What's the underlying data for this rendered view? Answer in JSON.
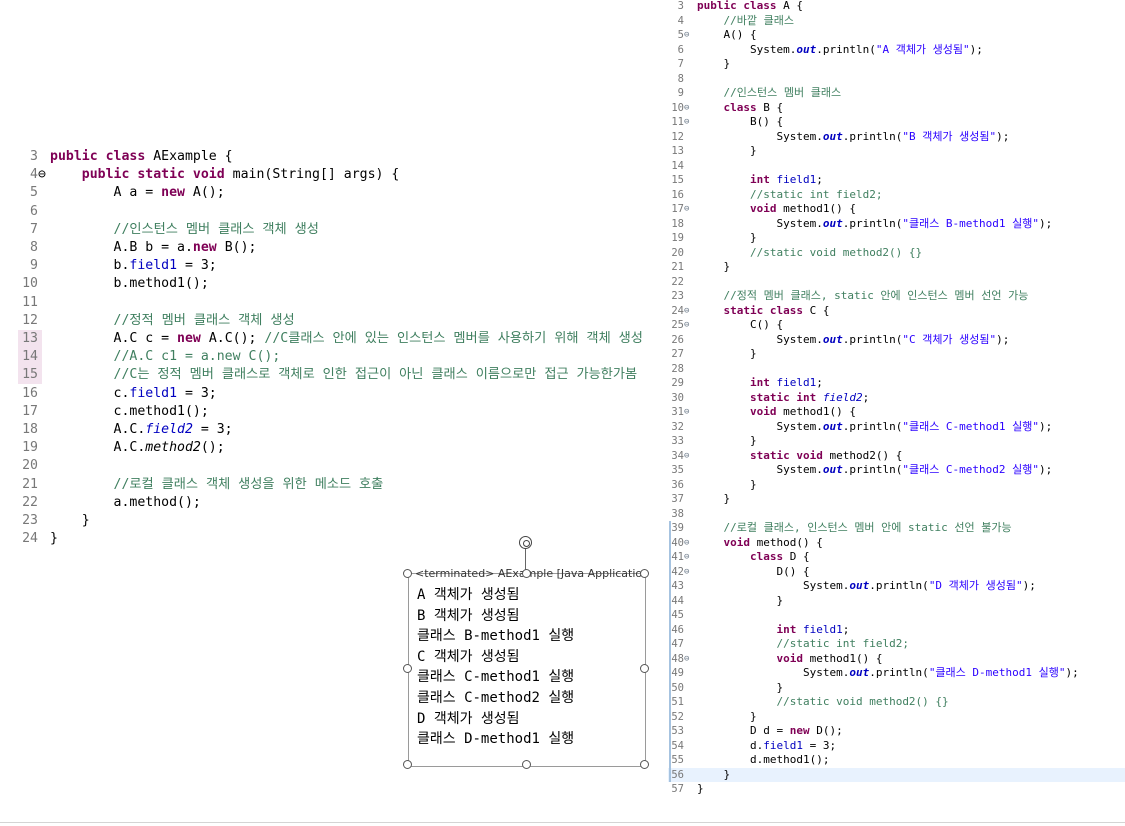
{
  "left_editor": {
    "lines": [
      {
        "n": "3",
        "tokens": [
          [
            "kw",
            "public class "
          ],
          [
            "",
            "AExample {"
          ]
        ]
      },
      {
        "n": "4",
        "fold": "⊖",
        "tokens": [
          [
            "",
            "    "
          ],
          [
            "kw",
            "public static void "
          ],
          [
            "",
            "main(String[] args) {"
          ]
        ]
      },
      {
        "n": "5",
        "tokens": [
          [
            "",
            "        A a = "
          ],
          [
            "kw",
            "new "
          ],
          [
            "",
            "A();"
          ]
        ]
      },
      {
        "n": "6",
        "tokens": []
      },
      {
        "n": "7",
        "tokens": [
          [
            "",
            "        "
          ],
          [
            "cm",
            "//인스턴스 멤버 클래스 객체 생성"
          ]
        ]
      },
      {
        "n": "8",
        "tokens": [
          [
            "",
            "        A.B b = a."
          ],
          [
            "kw",
            "new "
          ],
          [
            "",
            "B();"
          ]
        ]
      },
      {
        "n": "9",
        "tokens": [
          [
            "",
            "        b."
          ],
          [
            "fd",
            "field1"
          ],
          [
            "",
            " = 3;"
          ]
        ]
      },
      {
        "n": "10",
        "tokens": [
          [
            "",
            "        b.method1();"
          ]
        ]
      },
      {
        "n": "11",
        "tokens": []
      },
      {
        "n": "12",
        "tokens": [
          [
            "",
            "        "
          ],
          [
            "cm",
            "//정적 멤버 클래스 객체 생성"
          ]
        ]
      },
      {
        "n": "13",
        "hl": true,
        "tokens": [
          [
            "",
            "        A.C c = "
          ],
          [
            "kw",
            "new "
          ],
          [
            "",
            "A.C(); "
          ],
          [
            "cm",
            "//C클래스 안에 있는 인스턴스 멤버를 사용하기 위해 객체 생성"
          ]
        ]
      },
      {
        "n": "14",
        "hl": true,
        "tokens": [
          [
            "",
            "        "
          ],
          [
            "cm",
            "//A.C c1 = a.new C();"
          ]
        ]
      },
      {
        "n": "15",
        "hl": true,
        "tokens": [
          [
            "",
            "        "
          ],
          [
            "cm",
            "//C는 정적 멤버 클래스로 객체로 인한 접근이 아닌 클래스 이름으로만 접근 가능한가봄"
          ]
        ]
      },
      {
        "n": "16",
        "tokens": [
          [
            "",
            "        c."
          ],
          [
            "fd",
            "field1"
          ],
          [
            "",
            " = 3;"
          ]
        ]
      },
      {
        "n": "17",
        "tokens": [
          [
            "",
            "        c.method1();"
          ]
        ]
      },
      {
        "n": "18",
        "tokens": [
          [
            "",
            "        A.C."
          ],
          [
            "sfd",
            "field2"
          ],
          [
            "",
            " = 3;"
          ]
        ]
      },
      {
        "n": "19",
        "tokens": [
          [
            "",
            "        A.C."
          ],
          [
            "ita",
            "method2"
          ],
          [
            "",
            "();"
          ]
        ]
      },
      {
        "n": "20",
        "tokens": []
      },
      {
        "n": "21",
        "tokens": [
          [
            "",
            "        "
          ],
          [
            "cm",
            "//로컬 클래스 객체 생성을 위한 메소드 호출"
          ]
        ]
      },
      {
        "n": "22",
        "tokens": [
          [
            "",
            "        a.method();"
          ]
        ]
      },
      {
        "n": "23",
        "tokens": [
          [
            "",
            "    }"
          ]
        ]
      },
      {
        "n": "24",
        "tokens": [
          [
            "",
            "}"
          ]
        ]
      }
    ]
  },
  "right_editor": {
    "lines": [
      {
        "n": "3",
        "tokens": [
          [
            "kw",
            "public class "
          ],
          [
            "",
            "A {"
          ]
        ]
      },
      {
        "n": "4",
        "tokens": [
          [
            "",
            "    "
          ],
          [
            "cm",
            "//바깥 클래스"
          ]
        ]
      },
      {
        "n": "5",
        "fold": "⊖",
        "tokens": [
          [
            "",
            "    A() {"
          ]
        ]
      },
      {
        "n": "6",
        "tokens": [
          [
            "",
            "        System."
          ],
          [
            "sobj",
            "out"
          ],
          [
            "",
            ".println("
          ],
          [
            "st",
            "\"A 객체가 생성됨\""
          ],
          [
            "",
            ");"
          ]
        ]
      },
      {
        "n": "7",
        "tokens": [
          [
            "",
            "    }"
          ]
        ]
      },
      {
        "n": "8",
        "tokens": []
      },
      {
        "n": "9",
        "tokens": [
          [
            "",
            "    "
          ],
          [
            "cm",
            "//인스턴스 멤버 클래스"
          ]
        ]
      },
      {
        "n": "10",
        "fold": "⊖",
        "tokens": [
          [
            "",
            "    "
          ],
          [
            "kw",
            "class "
          ],
          [
            "",
            "B {"
          ]
        ]
      },
      {
        "n": "11",
        "fold": "⊖",
        "tokens": [
          [
            "",
            "        B() {"
          ]
        ]
      },
      {
        "n": "12",
        "tokens": [
          [
            "",
            "            System."
          ],
          [
            "sobj",
            "out"
          ],
          [
            "",
            ".println("
          ],
          [
            "st",
            "\"B 객체가 생성됨\""
          ],
          [
            "",
            ");"
          ]
        ]
      },
      {
        "n": "13",
        "tokens": [
          [
            "",
            "        }"
          ]
        ]
      },
      {
        "n": "14",
        "tokens": []
      },
      {
        "n": "15",
        "tokens": [
          [
            "",
            "        "
          ],
          [
            "kw",
            "int "
          ],
          [
            "fd",
            "field1"
          ],
          [
            "",
            ";"
          ]
        ]
      },
      {
        "n": "16",
        "tokens": [
          [
            "",
            "        "
          ],
          [
            "cm",
            "//static int field2;"
          ]
        ]
      },
      {
        "n": "17",
        "fold": "⊖",
        "tokens": [
          [
            "",
            "        "
          ],
          [
            "kw",
            "void "
          ],
          [
            "",
            "method1() {"
          ]
        ]
      },
      {
        "n": "18",
        "tokens": [
          [
            "",
            "            System."
          ],
          [
            "sobj",
            "out"
          ],
          [
            "",
            ".println("
          ],
          [
            "st",
            "\"클래스 B-method1 실행\""
          ],
          [
            "",
            ");"
          ]
        ]
      },
      {
        "n": "19",
        "tokens": [
          [
            "",
            "        }"
          ]
        ]
      },
      {
        "n": "20",
        "tokens": [
          [
            "",
            "        "
          ],
          [
            "cm",
            "//static void method2() {}"
          ]
        ]
      },
      {
        "n": "21",
        "tokens": [
          [
            "",
            "    }"
          ]
        ]
      },
      {
        "n": "22",
        "tokens": []
      },
      {
        "n": "23",
        "tokens": [
          [
            "",
            "    "
          ],
          [
            "cm",
            "//정적 멤버 클래스, static 안에 인스턴스 멤버 선언 가능"
          ]
        ]
      },
      {
        "n": "24",
        "fold": "⊖",
        "tokens": [
          [
            "",
            "    "
          ],
          [
            "kw",
            "static class "
          ],
          [
            "",
            "C {"
          ]
        ]
      },
      {
        "n": "25",
        "fold": "⊖",
        "tokens": [
          [
            "",
            "        C() {"
          ]
        ]
      },
      {
        "n": "26",
        "tokens": [
          [
            "",
            "            System."
          ],
          [
            "sobj",
            "out"
          ],
          [
            "",
            ".println("
          ],
          [
            "st",
            "\"C 객체가 생성됨\""
          ],
          [
            "",
            ");"
          ]
        ]
      },
      {
        "n": "27",
        "tokens": [
          [
            "",
            "        }"
          ]
        ]
      },
      {
        "n": "28",
        "tokens": []
      },
      {
        "n": "29",
        "tokens": [
          [
            "",
            "        "
          ],
          [
            "kw",
            "int "
          ],
          [
            "fd",
            "field1"
          ],
          [
            "",
            ";"
          ]
        ]
      },
      {
        "n": "30",
        "tokens": [
          [
            "",
            "        "
          ],
          [
            "kw",
            "static int "
          ],
          [
            "sfd",
            "field2"
          ],
          [
            "",
            ";"
          ]
        ]
      },
      {
        "n": "31",
        "fold": "⊖",
        "tokens": [
          [
            "",
            "        "
          ],
          [
            "kw",
            "void "
          ],
          [
            "",
            "method1() {"
          ]
        ]
      },
      {
        "n": "32",
        "tokens": [
          [
            "",
            "            System."
          ],
          [
            "sobj",
            "out"
          ],
          [
            "",
            ".println("
          ],
          [
            "st",
            "\"클래스 C-method1 실행\""
          ],
          [
            "",
            ");"
          ]
        ]
      },
      {
        "n": "33",
        "tokens": [
          [
            "",
            "        }"
          ]
        ]
      },
      {
        "n": "34",
        "fold": "⊖",
        "tokens": [
          [
            "",
            "        "
          ],
          [
            "kw",
            "static void "
          ],
          [
            "",
            "method2() {"
          ]
        ]
      },
      {
        "n": "35",
        "tokens": [
          [
            "",
            "            System."
          ],
          [
            "sobj",
            "out"
          ],
          [
            "",
            ".println("
          ],
          [
            "st",
            "\"클래스 C-method2 실행\""
          ],
          [
            "",
            ");"
          ]
        ]
      },
      {
        "n": "36",
        "tokens": [
          [
            "",
            "        }"
          ]
        ]
      },
      {
        "n": "37",
        "tokens": [
          [
            "",
            "    }"
          ]
        ]
      },
      {
        "n": "38",
        "tokens": []
      },
      {
        "n": "39",
        "tokens": [
          [
            "",
            "    "
          ],
          [
            "cm",
            "//로컬 클래스, 인스턴스 멤버 안에 static 선언 불가능"
          ]
        ]
      },
      {
        "n": "40",
        "fold": "⊖",
        "tokens": [
          [
            "",
            "    "
          ],
          [
            "kw",
            "void "
          ],
          [
            "",
            "method() {"
          ]
        ]
      },
      {
        "n": "41",
        "fold": "⊖",
        "tokens": [
          [
            "",
            "        "
          ],
          [
            "kw",
            "class "
          ],
          [
            "",
            "D {"
          ]
        ]
      },
      {
        "n": "42",
        "fold": "⊖",
        "tokens": [
          [
            "",
            "            D() {"
          ]
        ]
      },
      {
        "n": "43",
        "tokens": [
          [
            "",
            "                System."
          ],
          [
            "sobj",
            "out"
          ],
          [
            "",
            ".println("
          ],
          [
            "st",
            "\"D 객체가 생성됨\""
          ],
          [
            "",
            ");"
          ]
        ]
      },
      {
        "n": "44",
        "tokens": [
          [
            "",
            "            }"
          ]
        ]
      },
      {
        "n": "45",
        "tokens": []
      },
      {
        "n": "46",
        "tokens": [
          [
            "",
            "            "
          ],
          [
            "kw",
            "int "
          ],
          [
            "fd",
            "field1"
          ],
          [
            "",
            ";"
          ]
        ]
      },
      {
        "n": "47",
        "tokens": [
          [
            "",
            "            "
          ],
          [
            "cm",
            "//static int field2;"
          ]
        ]
      },
      {
        "n": "48",
        "fold": "⊖",
        "tokens": [
          [
            "",
            "            "
          ],
          [
            "kw",
            "void "
          ],
          [
            "",
            "method1() {"
          ]
        ]
      },
      {
        "n": "49",
        "tokens": [
          [
            "",
            "                System."
          ],
          [
            "sobj",
            "out"
          ],
          [
            "",
            ".println("
          ],
          [
            "st",
            "\"클래스 D-method1 실행\""
          ],
          [
            "",
            ");"
          ]
        ]
      },
      {
        "n": "50",
        "tokens": [
          [
            "",
            "            }"
          ]
        ]
      },
      {
        "n": "51",
        "tokens": [
          [
            "",
            "            "
          ],
          [
            "cm",
            "//static void method2() {}"
          ]
        ]
      },
      {
        "n": "52",
        "tokens": [
          [
            "",
            "        }"
          ]
        ]
      },
      {
        "n": "53",
        "tokens": [
          [
            "",
            "        D d = "
          ],
          [
            "kw",
            "new "
          ],
          [
            "",
            "D();"
          ]
        ]
      },
      {
        "n": "54",
        "tokens": [
          [
            "",
            "        d."
          ],
          [
            "fd",
            "field1"
          ],
          [
            "",
            " = 3;"
          ]
        ]
      },
      {
        "n": "55",
        "tokens": [
          [
            "",
            "        d.method1();"
          ]
        ]
      },
      {
        "n": "56",
        "cur": true,
        "tokens": [
          [
            "",
            "    }"
          ]
        ]
      },
      {
        "n": "57",
        "tokens": [
          [
            "",
            "}"
          ]
        ]
      }
    ]
  },
  "console": {
    "header": "<terminated> AExample [Java Application]",
    "output": [
      "A 객체가 생성됨",
      "B 객체가 생성됨",
      "클래스 B-method1 실행",
      "C 객체가 생성됨",
      "클래스 C-method1 실행",
      "클래스 C-method2 실행",
      "D 객체가 생성됨",
      "클래스 D-method1 실행"
    ]
  }
}
